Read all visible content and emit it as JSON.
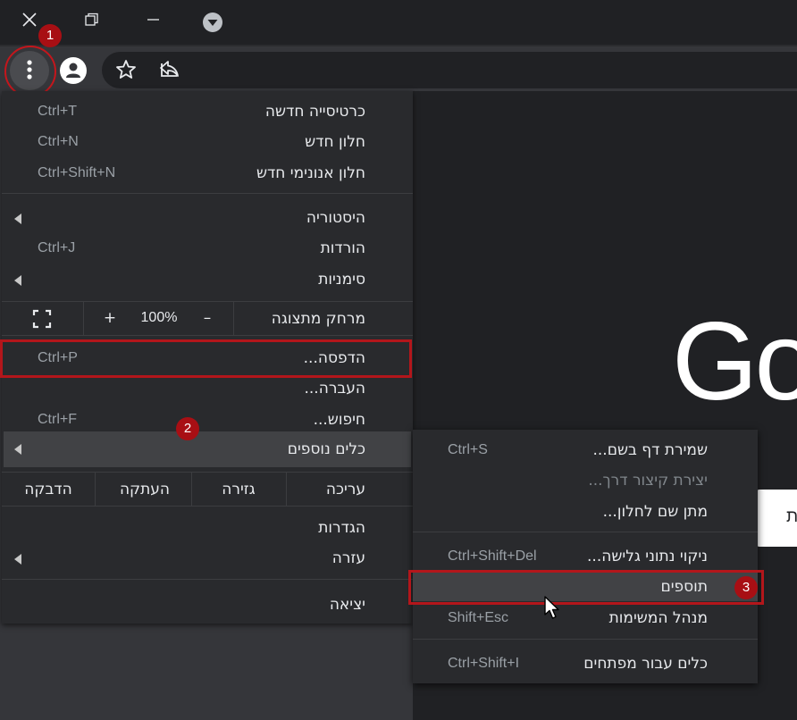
{
  "window_controls": {
    "close_icon": "close-icon",
    "restore_icon": "restore-icon",
    "minimize_icon": "minimize-icon",
    "tab_search_icon": "chevron-down-icon"
  },
  "toolbar": {
    "menu_icon": "vertical-dots-icon",
    "profile_icon": "person-icon",
    "bookmark_icon": "star-icon",
    "share_icon": "share-icon"
  },
  "main_menu": {
    "group1": [
      {
        "label": "כרטיסייה חדשה",
        "shortcut": "Ctrl+T"
      },
      {
        "label": "חלון חדש",
        "shortcut": "Ctrl+N"
      },
      {
        "label": "חלון אנונימי חדש",
        "shortcut": "Ctrl+Shift+N"
      }
    ],
    "group2": [
      {
        "label": "היסטוריה",
        "shortcut": ""
      },
      {
        "label": "הורדות",
        "shortcut": "Ctrl+J"
      },
      {
        "label": "סימניות",
        "shortcut": ""
      }
    ],
    "zoom": {
      "label": "מרחק מתצוגה",
      "minus": "–",
      "level": "100%",
      "plus": "+"
    },
    "group3": [
      {
        "label": "הדפסה...",
        "shortcut": "Ctrl+P"
      },
      {
        "label": "העברה...",
        "shortcut": ""
      },
      {
        "label": "חיפוש...",
        "shortcut": "Ctrl+F"
      }
    ],
    "more_tools": {
      "label": "כלים נוספים"
    },
    "edit": {
      "label": "עריכה",
      "cut": "גזירה",
      "copy": "העתקה",
      "paste": "הדבקה"
    },
    "group4": [
      {
        "label": "הגדרות",
        "shortcut": ""
      },
      {
        "label": "עזרה",
        "shortcut": ""
      }
    ],
    "exit": {
      "label": "יציאה"
    }
  },
  "sub_menu": {
    "group1": [
      {
        "label": "שמירת דף בשם...",
        "shortcut": "Ctrl+S"
      },
      {
        "label": "יצירת קיצור דרך...",
        "shortcut": ""
      },
      {
        "label": "מתן שם לחלון...",
        "shortcut": ""
      }
    ],
    "group2": [
      {
        "label": "ניקוי נתוני גלישה...",
        "shortcut": "Ctrl+Shift+Del"
      },
      {
        "label": "תוספים",
        "shortcut": ""
      },
      {
        "label": "מנהל המשימות",
        "shortcut": "Shift+Esc"
      }
    ],
    "group3": [
      {
        "label": "כלים עבור מפתחים",
        "shortcut": "Ctrl+Shift+I"
      }
    ]
  },
  "page": {
    "logo_text": "Go",
    "search_partial": "ת את"
  },
  "annotations": {
    "step1": "1",
    "step2": "2",
    "step3": "3",
    "highlight_color": "#b3161b"
  },
  "colors": {
    "menu_bg": "#292a2d",
    "hover_bg": "#414245",
    "titlebar_bg": "#202124",
    "toolbar_bg": "#35363a"
  }
}
